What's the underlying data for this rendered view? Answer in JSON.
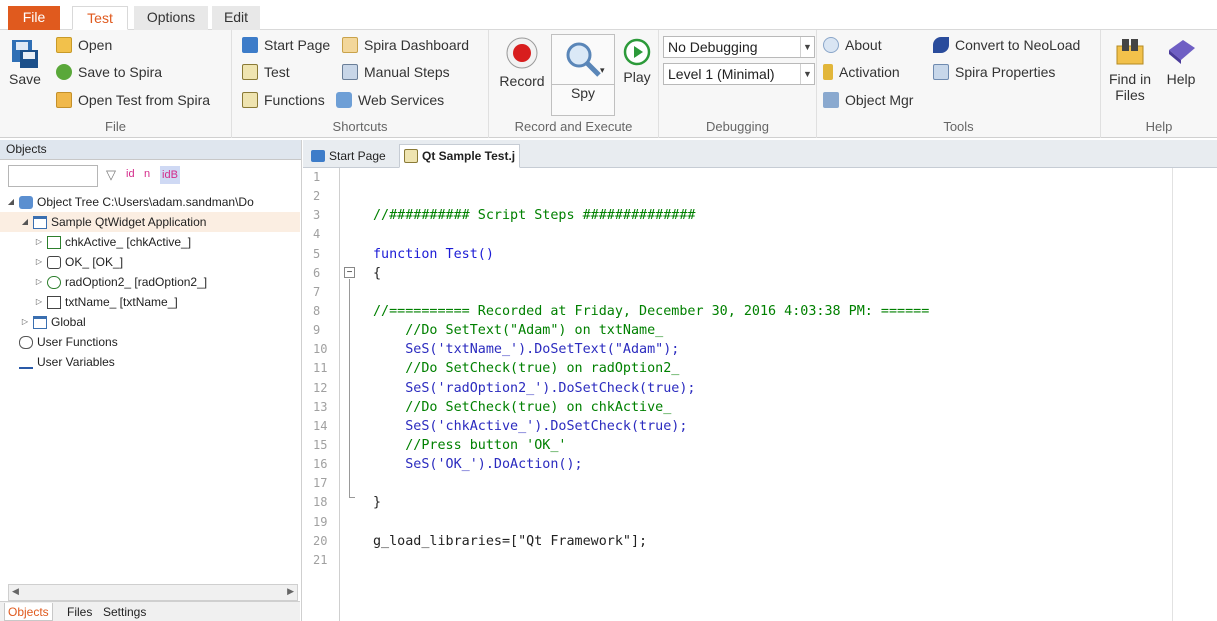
{
  "menu": {
    "file": "File",
    "test": "Test",
    "options": "Options",
    "edit": "Edit"
  },
  "ribbon": {
    "file_group": {
      "label": "File",
      "save": "Save",
      "open": "Open",
      "save_to_spira": "Save to Spira",
      "open_from_spira": "Open Test from Spira"
    },
    "shortcuts_group": {
      "label": "Shortcuts",
      "start_page": "Start Page",
      "spira_dashboard": "Spira Dashboard",
      "test": "Test",
      "manual_steps": "Manual Steps",
      "functions": "Functions",
      "web_services": "Web Services"
    },
    "record_group": {
      "label": "Record and Execute",
      "record": "Record",
      "spy": "Spy",
      "play": "Play"
    },
    "debugging_group": {
      "label": "Debugging",
      "debug_mode": "No Debugging",
      "level": "Level 1 (Minimal)"
    },
    "tools_group": {
      "label": "Tools",
      "about": "About",
      "convert": "Convert to NeoLoad",
      "activation": "Activation",
      "spira_properties": "Spira Properties",
      "object_mgr": "Object Mgr"
    },
    "help_group": {
      "label": "Help",
      "find_in_files_1": "Find in",
      "find_in_files_2": "Files",
      "help": "Help"
    }
  },
  "objects_panel": {
    "title": "Objects",
    "filter_id": "id",
    "filter_n": "n",
    "filter_idb": "id",
    "tree": [
      {
        "label": "Object Tree C:\\Users\\adam.sandman\\Do",
        "level": 0,
        "expander": "◢",
        "icon": "tree-root-icon"
      },
      {
        "label": "Sample QtWidget Application",
        "level": 1,
        "expander": "◢",
        "icon": "window-icon"
      },
      {
        "label": "chkActive_ [chkActive_]",
        "level": 2,
        "expander": "▷",
        "icon": "checkbox-icon"
      },
      {
        "label": "OK_ [OK_]",
        "level": 2,
        "expander": "▷",
        "icon": "button-icon"
      },
      {
        "label": "radOption2_ [radOption2_]",
        "level": 2,
        "expander": "▷",
        "icon": "radio-icon"
      },
      {
        "label": "txtName_ [txtName_]",
        "level": 2,
        "expander": "▷",
        "icon": "textbox-icon"
      },
      {
        "label": "Global",
        "level": 1,
        "expander": "▷",
        "icon": "window-icon"
      },
      {
        "label": "User Functions",
        "level": 0,
        "expander": "",
        "icon": "functions-icon"
      },
      {
        "label": "User Variables",
        "level": 0,
        "expander": "",
        "icon": "variables-icon"
      }
    ],
    "bottom_tabs": [
      "Objects",
      "Files",
      "Settings"
    ]
  },
  "editor": {
    "tabs": [
      "Start Page",
      "Qt Sample Test.j"
    ],
    "line_numbers": [
      "1",
      "2",
      "3",
      "4",
      "5",
      "6",
      "7",
      "8",
      "9",
      "10",
      "11",
      "12",
      "13",
      "14",
      "15",
      "16",
      "17",
      "18",
      "19",
      "20",
      "21"
    ],
    "lines": [
      "",
      "",
      "//########## Script Steps ##############",
      "",
      "function Test()",
      "{",
      "",
      "//========== Recorded at Friday, December 30, 2016 4:03:38 PM: ======",
      "    //Do SetText(\"Adam\") on txtName_",
      "    SeS('txtName_').DoSetText(\"Adam\");",
      "    //Do SetCheck(true) on radOption2_",
      "    SeS('radOption2_').DoSetCheck(true);",
      "    //Do SetCheck(true) on chkActive_",
      "    SeS('chkActive_').DoSetCheck(true);",
      "    //Press button 'OK_'",
      "    SeS('OK_').DoAction();",
      "",
      "}",
      "",
      "g_load_libraries=[\"Qt Framework\"];",
      ""
    ]
  }
}
